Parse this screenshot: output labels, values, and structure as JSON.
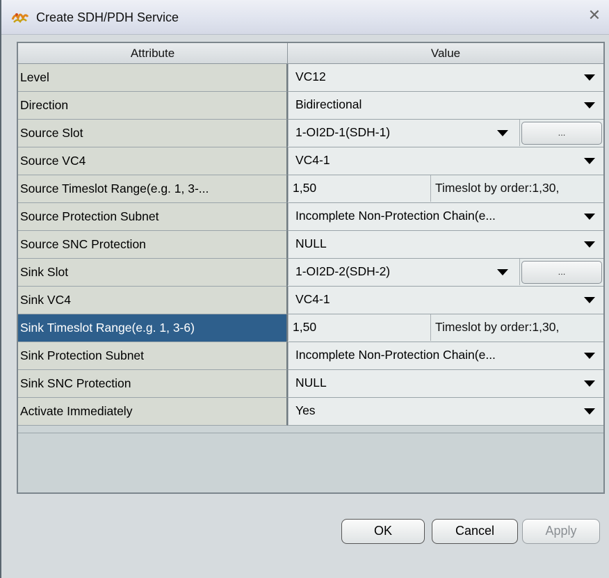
{
  "window": {
    "title": "Create SDH/PDH Service",
    "icon": "app-logo-icon",
    "close_glyph": "✕"
  },
  "table": {
    "headers": {
      "attribute": "Attribute",
      "value": "Value"
    },
    "rows": [
      {
        "attribute": "Level",
        "value": "VC12",
        "kind": "combo"
      },
      {
        "attribute": "Direction",
        "value": "Bidirectional",
        "kind": "combo"
      },
      {
        "attribute": "Source Slot",
        "value": "1-OI2D-1(SDH-1)",
        "kind": "slot",
        "button": "..."
      },
      {
        "attribute": "Source VC4",
        "value": "VC4-1",
        "kind": "combo"
      },
      {
        "attribute": "Source Timeslot Range(e.g. 1, 3-...",
        "value": "1,50",
        "kind": "timeslot",
        "extra": "Timeslot by order:1,30,"
      },
      {
        "attribute": "Source Protection Subnet",
        "value": "Incomplete Non-Protection Chain(e...",
        "kind": "combo"
      },
      {
        "attribute": "Source SNC Protection",
        "value": "NULL",
        "kind": "combo"
      },
      {
        "attribute": "Sink Slot",
        "value": "1-OI2D-2(SDH-2)",
        "kind": "slot",
        "button": "..."
      },
      {
        "attribute": "Sink VC4",
        "value": "VC4-1",
        "kind": "combo"
      },
      {
        "attribute": "Sink Timeslot Range(e.g. 1, 3-6)",
        "value": "1,50",
        "kind": "timeslot",
        "extra": "Timeslot by order:1,30,",
        "selected": true
      },
      {
        "attribute": "Sink Protection Subnet",
        "value": "Incomplete Non-Protection Chain(e...",
        "kind": "combo"
      },
      {
        "attribute": "Sink SNC Protection",
        "value": "NULL",
        "kind": "combo"
      },
      {
        "attribute": "Activate Immediately",
        "value": "Yes",
        "kind": "combo"
      }
    ]
  },
  "buttons": {
    "ok": "OK",
    "cancel": "Cancel",
    "apply": "Apply"
  }
}
